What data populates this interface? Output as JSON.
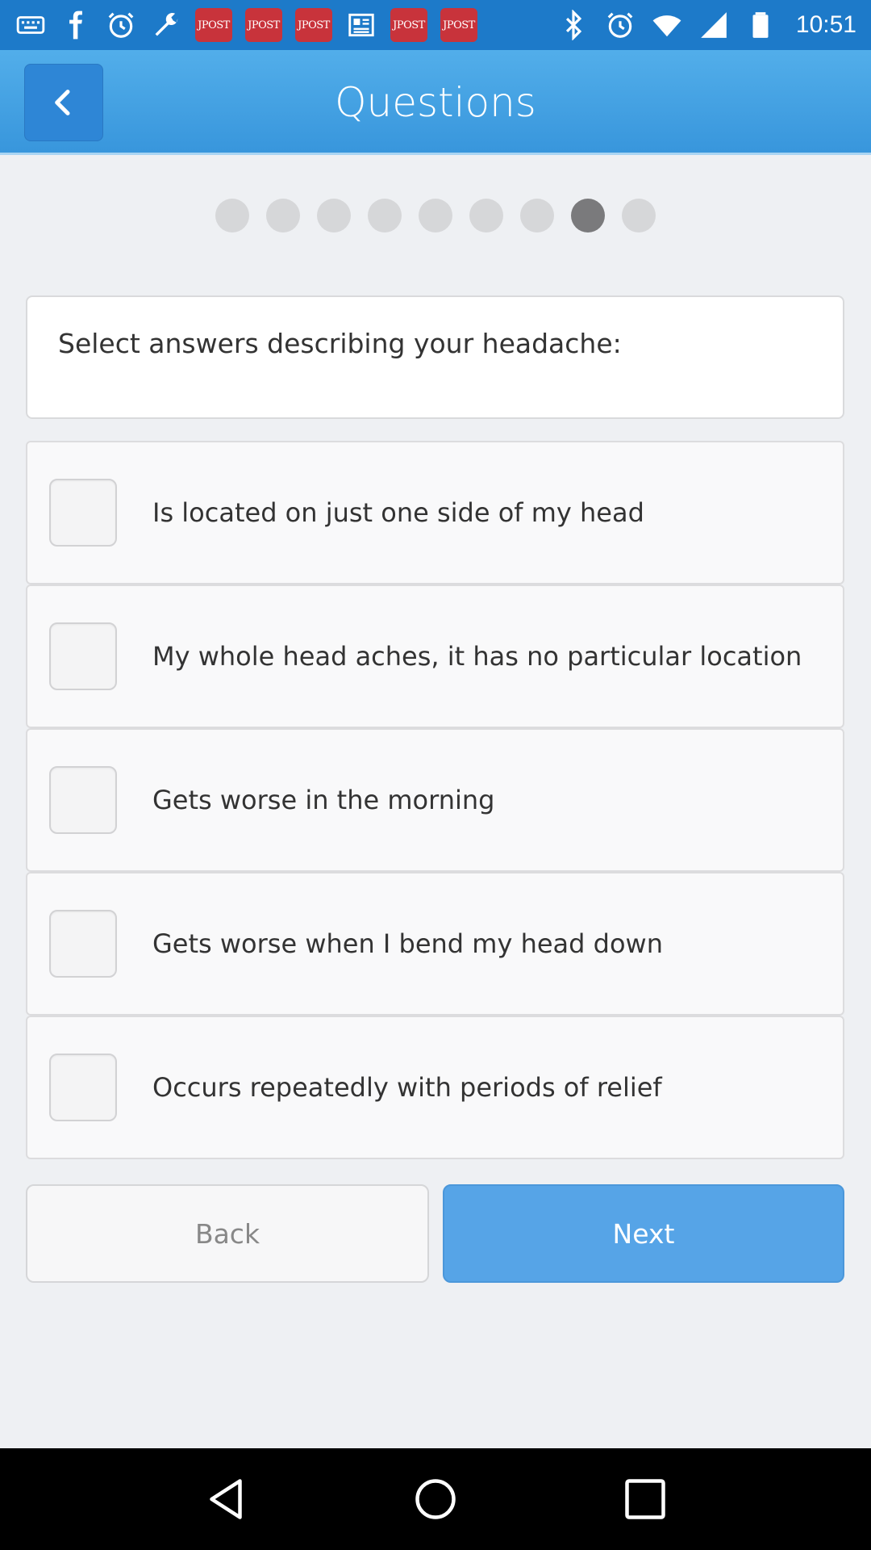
{
  "status_bar": {
    "time": "10:51",
    "notification_label": "JPOST",
    "notification_count": 5
  },
  "header": {
    "title": "Questions"
  },
  "progress": {
    "total_steps": 9,
    "current_step": 8
  },
  "question": {
    "prompt": "Select answers describing your headache:"
  },
  "options": [
    {
      "label": "Is located on just one side of my head",
      "checked": false
    },
    {
      "label": "My whole head aches, it has no particular location",
      "checked": false
    },
    {
      "label": "Gets worse in the morning",
      "checked": false
    },
    {
      "label": "Gets worse when I bend my head down",
      "checked": false
    },
    {
      "label": "Occurs repeatedly with periods of relief",
      "checked": false
    }
  ],
  "buttons": {
    "back_label": "Back",
    "next_label": "Next"
  },
  "colors": {
    "header_blue": "#3896dc",
    "next_button": "#56a4e7",
    "active_dot": "#7a7a7c",
    "inactive_dot": "#d6d7d9"
  }
}
